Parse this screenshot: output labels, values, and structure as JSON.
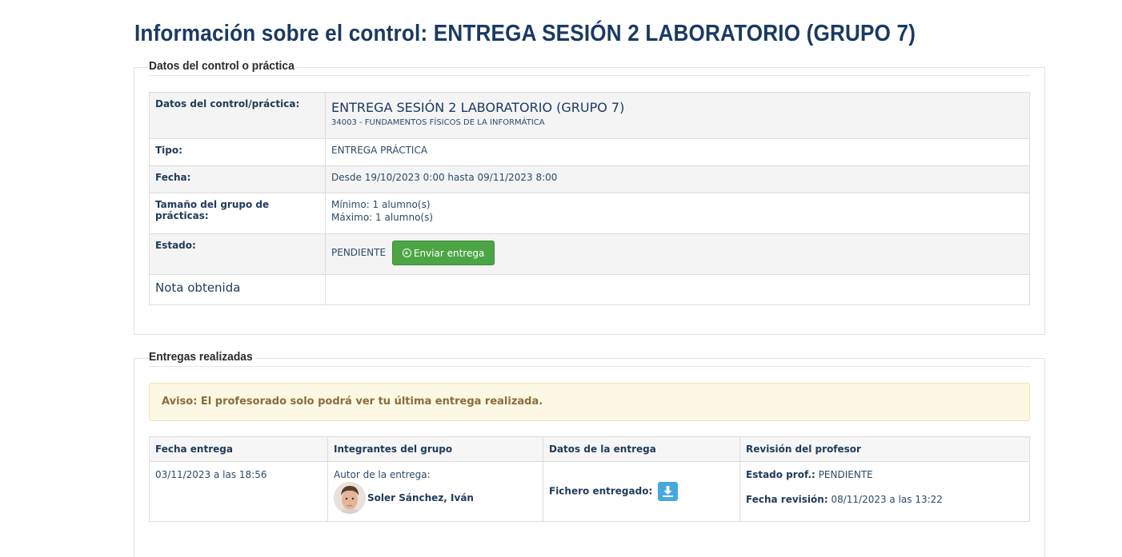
{
  "page": {
    "title": "Información sobre el control: ENTREGA SESIÓN 2 LABORATORIO (GRUPO 7)"
  },
  "control_section": {
    "legend": "Datos del control o práctica",
    "rows": {
      "datos": {
        "label": "Datos del control/práctica:",
        "title": "ENTREGA SESIÓN 2 LABORATORIO (GRUPO 7)",
        "course": "34003 - FUNDAMENTOS FÍSICOS DE LA INFORMÁTICA"
      },
      "tipo": {
        "label": "Tipo:",
        "value": "ENTREGA PRÁCTICA"
      },
      "fecha": {
        "label": "Fecha:",
        "value": "Desde 19/10/2023 0:00 hasta 09/11/2023 8:00"
      },
      "grupo": {
        "label": "Tamaño del grupo de prácticas:",
        "min": "Mínimo: 1 alumno(s)",
        "max": "Máximo: 1 alumno(s)"
      },
      "estado": {
        "label": "Estado:",
        "value": "PENDIENTE",
        "button": "Enviar entrega"
      },
      "nota": {
        "label": "Nota obtenida",
        "value": ""
      }
    }
  },
  "deliveries_section": {
    "legend": "Entregas realizadas",
    "notice": "Aviso: El profesorado solo podrá ver tu última entrega realizada.",
    "headers": [
      "Fecha entrega",
      "Integrantes del grupo",
      "Datos de la entrega",
      "Revisión del profesor"
    ],
    "rows": [
      {
        "fecha": "03/11/2023 a las 18:56",
        "autor_label": "Autor de la entrega:",
        "autor": "Soler Sánchez, Iván",
        "fichero_label": "Fichero entregado:",
        "estado_prof_label": "Estado prof.:",
        "estado_prof": "PENDIENTE",
        "fecha_revision_label": "Fecha revisión:",
        "fecha_revision": "08/11/2023 a las 13:22"
      }
    ]
  },
  "colors": {
    "title": "#1b3a63",
    "send_button": "#4ca545",
    "download_button": "#45a9dc",
    "notice_bg": "#fcf8e3",
    "notice_text": "#8a6d3b"
  },
  "icons": {
    "send": "circle-arrow-up-icon",
    "download": "download-icon"
  }
}
